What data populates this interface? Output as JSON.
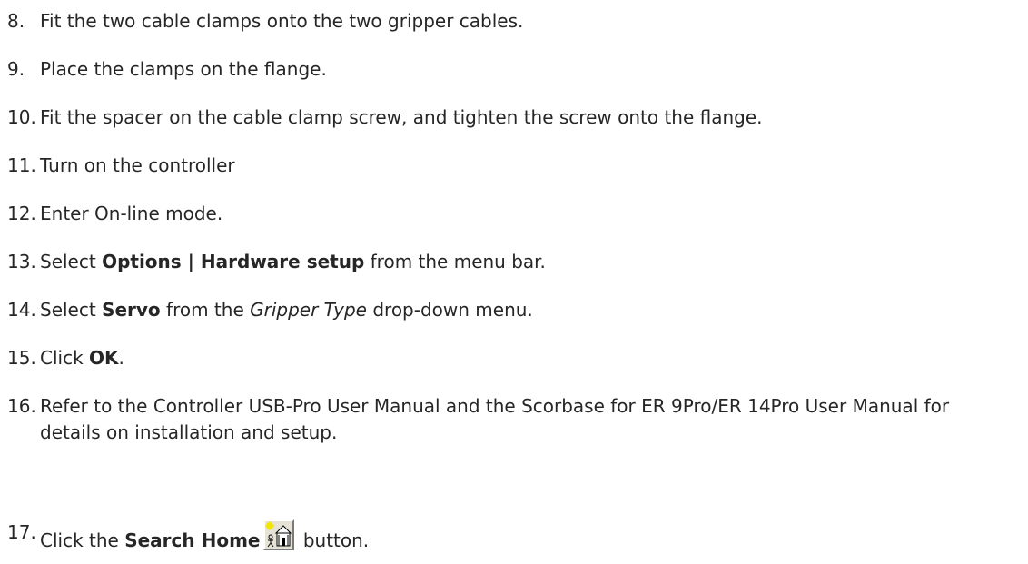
{
  "steps": [
    {
      "num": "8.",
      "text": "Fit the two cable clamps onto the two gripper cables."
    },
    {
      "num": "9.",
      "text": "Place the clamps on the flange."
    },
    {
      "num": "10.",
      "text": "Fit the spacer on the cable clamp screw, and tighten the screw onto the flange."
    },
    {
      "num": "11.",
      "text": "Turn on the controller"
    },
    {
      "num": "12.",
      "text": "Enter On-line mode."
    },
    {
      "num": "13.",
      "pre": "Select ",
      "bold": "Options | Hardware setup",
      "post": " from the menu bar."
    },
    {
      "num": "14.",
      "pre": "Select ",
      "bold": "Servo",
      "mid": " from the ",
      "italic": "Gripper Type",
      "post": " drop-down menu."
    },
    {
      "num": "15.",
      "pre": "Click ",
      "bold": "OK",
      "post": "."
    },
    {
      "num": "16.",
      "text": "Refer to the Controller USB-Pro User Manual and the Scorbase for ER 9Pro/ER 14Pro User Manual for details on installation and setup."
    },
    {
      "num": "17.",
      "pre": "Click the ",
      "bold": "Search Home",
      "post": " button.",
      "icon": "search-home-icon"
    }
  ]
}
